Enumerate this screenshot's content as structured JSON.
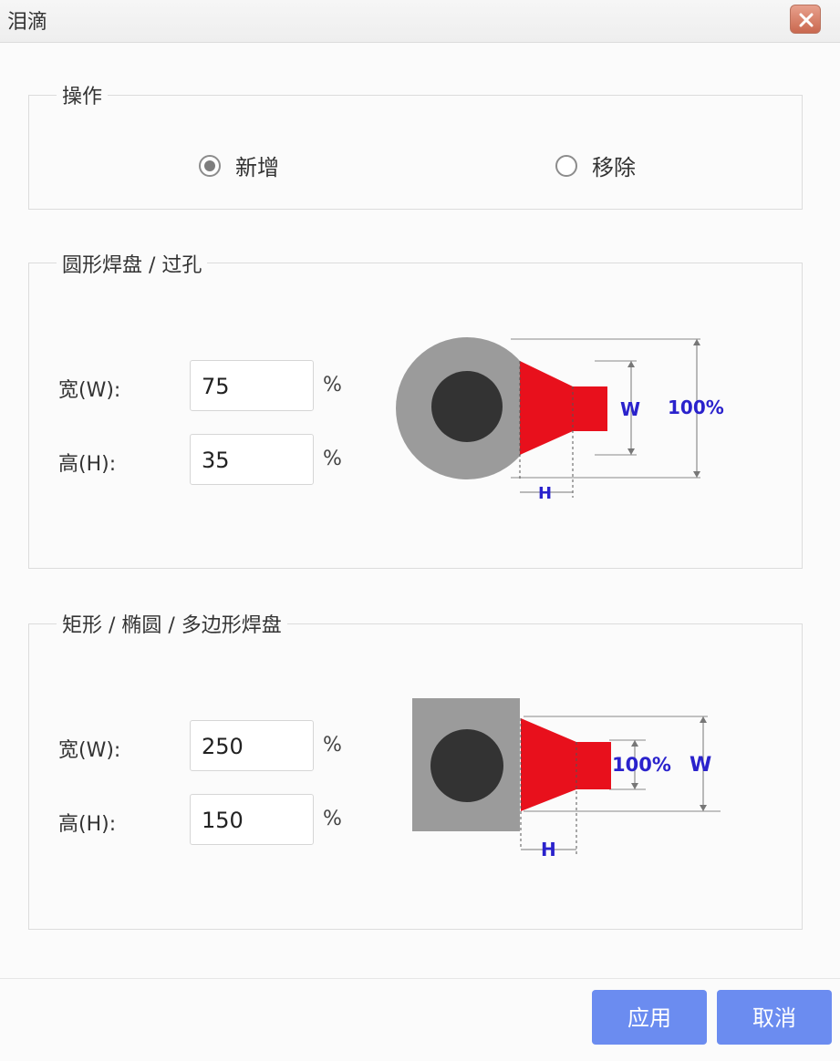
{
  "window": {
    "title": "泪滴"
  },
  "operation": {
    "legend": "操作",
    "options": [
      {
        "label": "新增",
        "checked": true
      },
      {
        "label": "移除",
        "checked": false
      }
    ]
  },
  "round_pad": {
    "legend": "圆形焊盘 / 过孔",
    "width_label": "宽(W):",
    "width_value": "75",
    "height_label": "高(H):",
    "height_value": "35",
    "unit": "%",
    "diagram": {
      "w_label": "W",
      "full_label": "100%",
      "h_label": "H"
    }
  },
  "rect_pad": {
    "legend": "矩形 / 椭圆 / 多边形焊盘",
    "width_label": "宽(W):",
    "width_value": "250",
    "height_label": "高(H):",
    "height_value": "150",
    "unit": "%",
    "diagram": {
      "full_label": "100%",
      "w_label": "W",
      "h_label": "H"
    }
  },
  "buttons": {
    "apply": "应用",
    "cancel": "取消"
  },
  "colors": {
    "accent_button": "#6b8cf0",
    "teardrop_red": "#e8101c",
    "pad_gray": "#9b9b9b",
    "hole_dark": "#333333",
    "dimension_text": "#2a22cc"
  }
}
